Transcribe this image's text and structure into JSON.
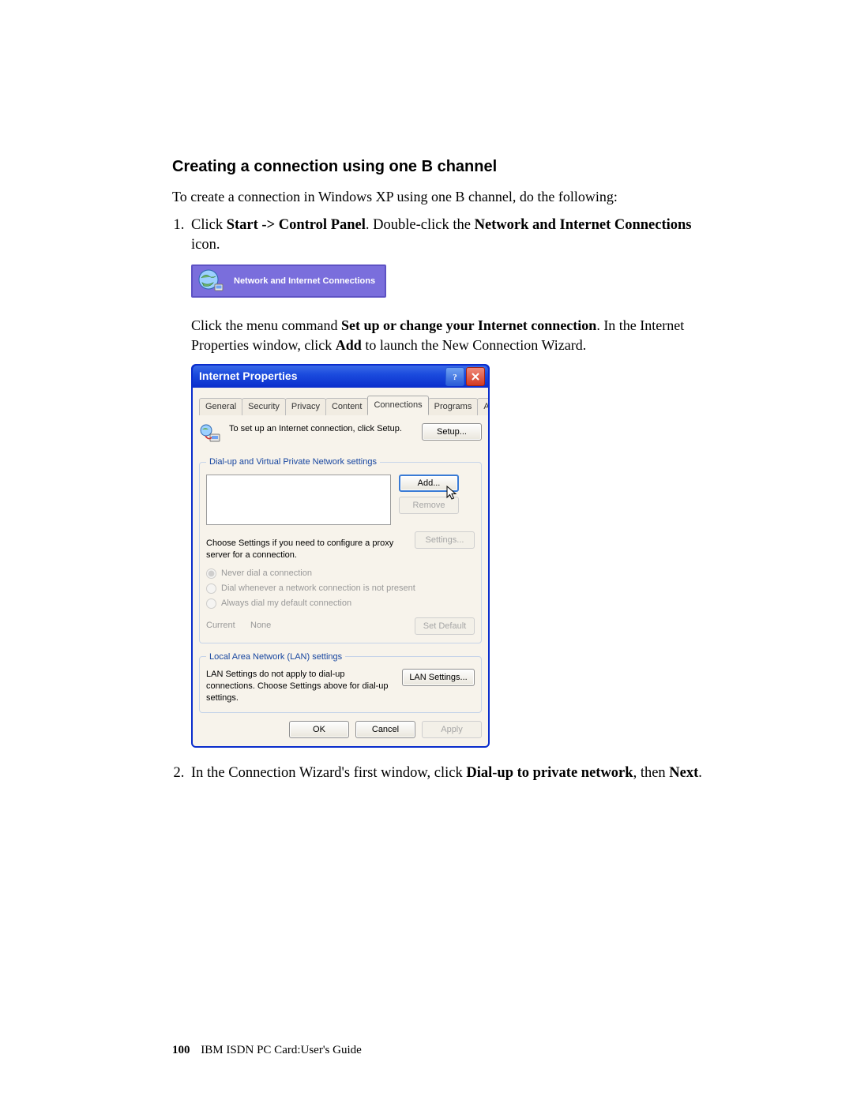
{
  "heading": "Creating a connection using one B channel",
  "intro": "To create a connection in Windows XP using one B channel, do the following:",
  "step1": {
    "pre": "Click ",
    "b1": "Start -> Control Panel",
    "mid": ". Double-click the ",
    "b2": "Network and Internet Connections",
    "post": " icon."
  },
  "nic_card_label": "Network and Internet Connections",
  "para2": {
    "pre": "Click the menu command ",
    "b1": "Set up or change your Internet connection",
    "mid": ". In the Internet Properties window, click ",
    "b2": "Add",
    "post": " to launch the New Connection Wizard."
  },
  "dialog": {
    "title": "Internet Properties",
    "tabs": [
      "General",
      "Security",
      "Privacy",
      "Content",
      "Connections",
      "Programs",
      "Advanced"
    ],
    "active_tab_index": 4,
    "setup_text": "To set up an Internet connection, click Setup.",
    "btn_setup": "Setup...",
    "group_dialup": "Dial-up and Virtual Private Network settings",
    "btn_add": "Add...",
    "btn_remove": "Remove",
    "proxy_text": "Choose Settings if you need to configure a proxy server for a connection.",
    "btn_settings": "Settings...",
    "radio1": "Never dial a connection",
    "radio2": "Dial whenever a network connection is not present",
    "radio3": "Always dial my default connection",
    "current_label": "Current",
    "current_value": "None",
    "btn_setdefault": "Set Default",
    "group_lan": "Local Area Network (LAN) settings",
    "lan_text": "LAN Settings do not apply to dial-up connections. Choose Settings above for dial-up settings.",
    "btn_lan": "LAN Settings...",
    "btn_ok": "OK",
    "btn_cancel": "Cancel",
    "btn_apply": "Apply"
  },
  "step2": {
    "pre": "In the Connection Wizard's first window, click ",
    "b1": "Dial-up to private network",
    "mid": ", then ",
    "b2": "Next",
    "post": "."
  },
  "footer": {
    "page": "100",
    "title": "IBM ISDN PC Card:User's Guide"
  }
}
